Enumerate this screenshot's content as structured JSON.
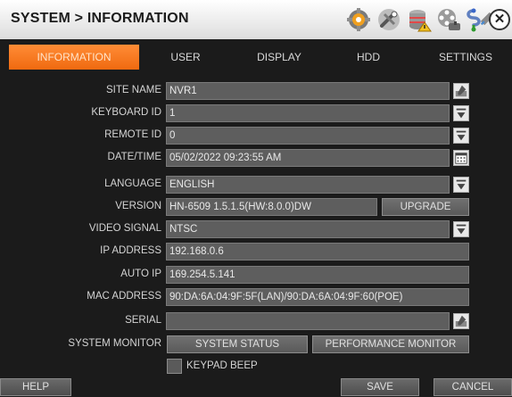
{
  "header": {
    "title": "SYSTEM > INFORMATION",
    "icons": [
      "gear-icon",
      "tools-icon",
      "database-alert-icon",
      "film-reel-icon",
      "network-icon",
      "usb-drive-icon"
    ],
    "close_label": "✕"
  },
  "tabs": [
    {
      "label": "INFORMATION",
      "active": true
    },
    {
      "label": "USER",
      "active": false
    },
    {
      "label": "DISPLAY",
      "active": false
    },
    {
      "label": "HDD",
      "active": false
    },
    {
      "label": "SETTINGS",
      "active": false
    }
  ],
  "form": {
    "site_name": {
      "label": "SITE NAME",
      "value": "NVR1"
    },
    "keyboard_id": {
      "label": "KEYBOARD ID",
      "value": "1"
    },
    "remote_id": {
      "label": "REMOTE ID",
      "value": "0"
    },
    "datetime": {
      "label": "DATE/TIME",
      "value": "05/02/2022 09:23:55 AM"
    },
    "language": {
      "label": "LANGUAGE",
      "value": "ENGLISH"
    },
    "version": {
      "label": "VERSION",
      "value": "HN-6509 1.5.1.5(HW:8.0.0)DW",
      "upgrade_label": "UPGRADE"
    },
    "video_signal": {
      "label": "VIDEO SIGNAL",
      "value": "NTSC"
    },
    "ip_address": {
      "label": "IP ADDRESS",
      "value": "192.168.0.6"
    },
    "auto_ip": {
      "label": "AUTO IP",
      "value": "169.254.5.141"
    },
    "mac_address": {
      "label": "MAC ADDRESS",
      "value": "90:DA:6A:04:9F:5F(LAN)/90:DA:6A:04:9F:60(POE)"
    },
    "serial": {
      "label": "SERIAL",
      "value": ""
    },
    "system_monitor": {
      "label": "SYSTEM MONITOR",
      "status_label": "SYSTEM STATUS",
      "performance_label": "PERFORMANCE MONITOR"
    },
    "keypad_beep": {
      "label": "KEYPAD BEEP",
      "checked": false
    }
  },
  "footer": {
    "help_label": "HELP",
    "save_label": "SAVE",
    "cancel_label": "CANCEL"
  },
  "colors": {
    "accent": "#f47a20",
    "background": "#1b1b1b",
    "field": "#5e5e5e"
  }
}
